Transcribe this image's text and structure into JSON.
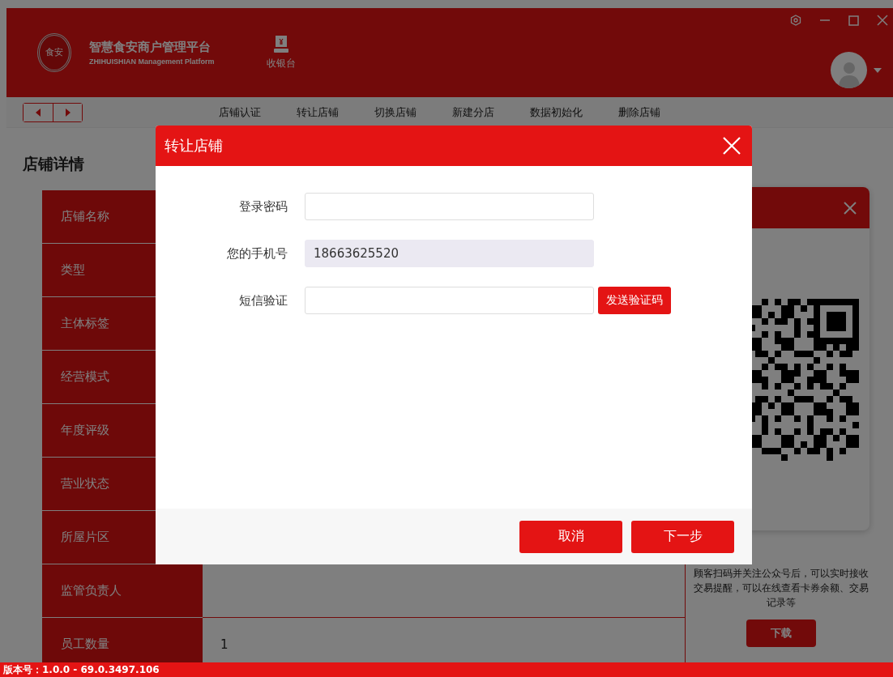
{
  "header": {
    "logo_text": "食安",
    "title": "智慧食安商户管理平台",
    "subtitle": "ZHIHUISHIAN Management Platform",
    "cashier": "收银台"
  },
  "toolbar": {
    "actions": [
      "店铺认证",
      "转让店铺",
      "切换店铺",
      "新建分店",
      "数据初始化",
      "删除店铺"
    ]
  },
  "page_title": "店铺详情",
  "details": [
    {
      "label": "店铺名称"
    },
    {
      "label": "类型"
    },
    {
      "label": "主体标签"
    },
    {
      "label": "经营模式"
    },
    {
      "label": "年度评级"
    },
    {
      "label": "营业状态"
    },
    {
      "label": "所屋片区"
    },
    {
      "label": "监管负责人"
    },
    {
      "label": "员工数量",
      "value": "1"
    }
  ],
  "qr_panel": {
    "description": "顾客扫码并关注公众号后，可以实时接收交易提醒，可以在线查看卡券余额、交易记录等",
    "download": "下载"
  },
  "status_bar": "版本号：1.0.0 - 69.0.3497.106",
  "dialog": {
    "title": "转让店铺",
    "fields": [
      {
        "label": "登录密码",
        "kind": "password"
      },
      {
        "label": "您的手机号",
        "kind": "readonly",
        "value": "18663625520"
      },
      {
        "label": "短信验证",
        "kind": "code",
        "button": "发送验证码"
      }
    ],
    "buttons": [
      {
        "label": "取消"
      },
      {
        "label": "下一步"
      }
    ]
  }
}
